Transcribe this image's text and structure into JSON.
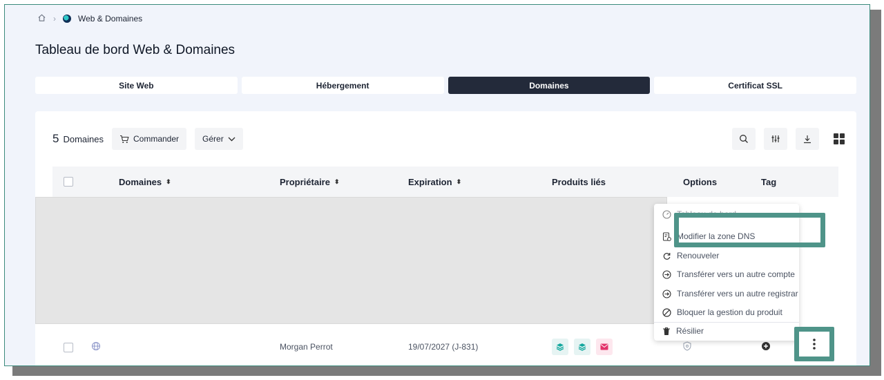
{
  "breadcrumb": {
    "current": "Web & Domaines"
  },
  "page_title": "Tableau de bord Web & Domaines",
  "tabs": [
    {
      "label": "Site Web"
    },
    {
      "label": "Hébergement"
    },
    {
      "label": "Domaines"
    },
    {
      "label": "Certificat SSL"
    }
  ],
  "toolbar": {
    "count": "5",
    "count_label": "Domaines",
    "order_label": "Commander",
    "manage_label": "Gérer"
  },
  "table": {
    "headers": {
      "domains": "Domaines",
      "owner": "Propriétaire",
      "expiration": "Expiration",
      "products": "Produits liés",
      "options": "Options",
      "tag": "Tag"
    },
    "row": {
      "owner": "Morgan Perrot",
      "expiration": "19/07/2027 (J-831)"
    }
  },
  "menu": {
    "items": [
      {
        "label": "Tableau de bord",
        "icon": "dashboard-icon"
      },
      {
        "label": "Modifier la zone DNS",
        "icon": "dns-icon"
      },
      {
        "label": "Renouveler",
        "icon": "refresh-icon"
      },
      {
        "label": "Transférer vers un autre compte",
        "icon": "transfer-icon"
      },
      {
        "label": "Transférer vers un autre registrar",
        "icon": "transfer-icon"
      },
      {
        "label": "Bloquer la gestion du produit",
        "icon": "block-icon"
      },
      {
        "label": "Résilier",
        "icon": "trash-icon"
      }
    ]
  },
  "colors": {
    "accent": "#4f9489",
    "active_tab": "#232a3a",
    "teal": "#12a79d",
    "pink": "#e2336b"
  }
}
